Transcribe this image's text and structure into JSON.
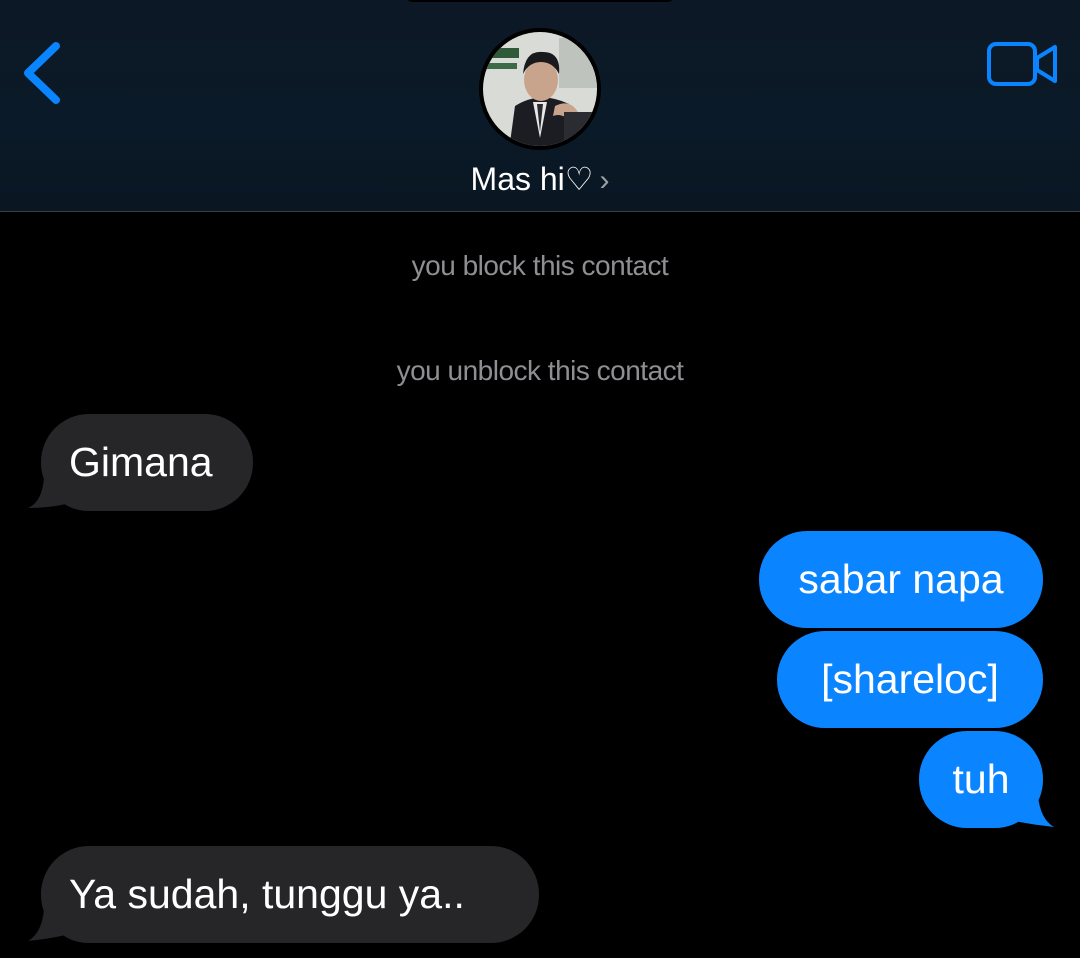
{
  "header": {
    "contact_name": "Mas hi♡",
    "chevron": "›",
    "back_icon": "chevron-left-icon",
    "video_icon": "video-camera-icon",
    "accent_color": "#0a84ff"
  },
  "system_messages": [
    {
      "text": "you block this contact"
    },
    {
      "text": "you unblock this contact"
    }
  ],
  "messages": [
    {
      "direction": "incoming",
      "text": "Gimana"
    },
    {
      "direction": "outgoing",
      "text": "sabar napa"
    },
    {
      "direction": "outgoing",
      "text": "[shareloc]"
    },
    {
      "direction": "outgoing",
      "text": "tuh"
    },
    {
      "direction": "incoming",
      "text": "Ya sudah, tunggu ya.."
    }
  ],
  "colors": {
    "incoming_bubble": "#262628",
    "outgoing_bubble": "#0a84ff",
    "system_text": "#8e8e93"
  }
}
